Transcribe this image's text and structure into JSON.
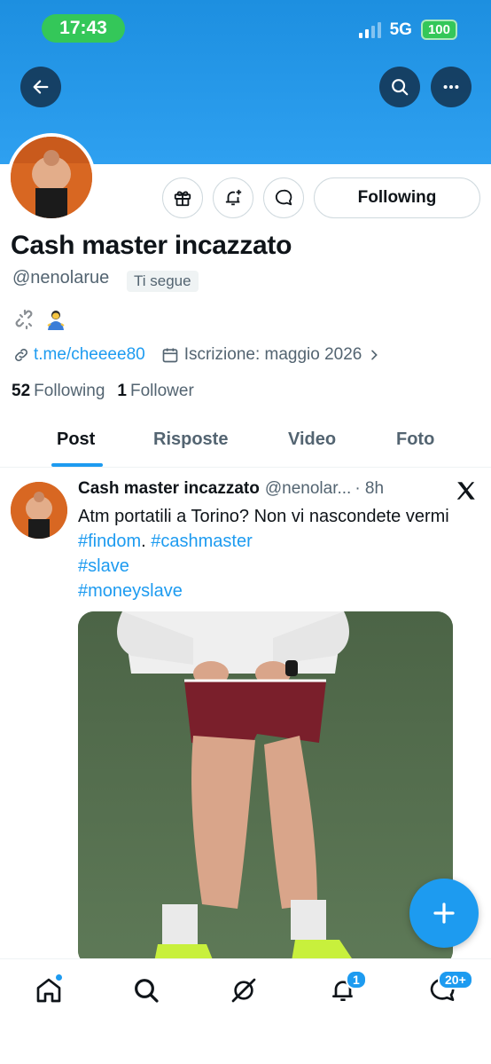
{
  "status_bar": {
    "time": "17:43",
    "network": "5G",
    "battery": "100"
  },
  "header": {
    "back_icon": "arrow-left-icon",
    "search_icon": "search-icon",
    "more_icon": "more-horizontal-icon"
  },
  "profile": {
    "name": "Cash master incazzato",
    "handle": "@nenolarue",
    "follows_you": "Ti segue",
    "bio_emojis": [
      "🔗",
      "🧎"
    ],
    "link": "t.me/cheeee80",
    "joined": "Iscrizione: maggio 2026",
    "following_count": "52",
    "following_label": "Following",
    "followers_count": "1",
    "followers_label": "Follower",
    "follow_button": "Following"
  },
  "tabs": [
    {
      "label": "Post"
    },
    {
      "label": "Risposte"
    },
    {
      "label": "Video"
    },
    {
      "label": "Foto"
    }
  ],
  "post": {
    "author": "Cash master incazzato",
    "handle": "@nenolar...",
    "time": "· 8h",
    "text": "Atm portatili a Torino? Non vi nascondete vermi",
    "hashtags": [
      "#findom",
      "#cashmaster",
      "#slave",
      "#moneyslave"
    ],
    "sep": "."
  },
  "bottom_nav": {
    "notifications_badge": "1",
    "messages_badge": "20+"
  },
  "colors": {
    "accent": "#1d9bf0",
    "banner": "#2ea0f0",
    "status_pill": "#34c759"
  }
}
